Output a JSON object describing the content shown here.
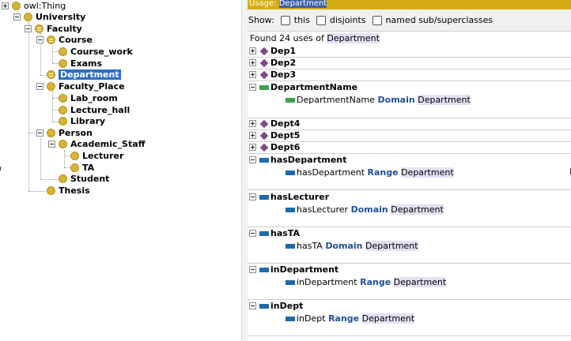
{
  "hierarchy": {
    "nodes": [
      {
        "id": "owl-thing",
        "label": "owl:Thing",
        "toggle": "plus",
        "icon": "class",
        "root": true
      },
      {
        "id": "university",
        "label": "University",
        "toggle": "minus",
        "icon": "class"
      },
      {
        "id": "faculty",
        "label": "Faculty",
        "toggle": "minus",
        "icon": "class-equivalent"
      },
      {
        "id": "course",
        "label": "Course",
        "toggle": "minus",
        "icon": "class-equivalent"
      },
      {
        "id": "course-work",
        "label": "Course_work",
        "toggle": "none",
        "icon": "class"
      },
      {
        "id": "exams",
        "label": "Exams",
        "toggle": "none",
        "icon": "class"
      },
      {
        "id": "department",
        "label": "Department",
        "toggle": "none",
        "icon": "class-equivalent",
        "selected": true
      },
      {
        "id": "faculty-place",
        "label": "Faculty_Place",
        "toggle": "minus",
        "icon": "class"
      },
      {
        "id": "lab-room",
        "label": "Lab_room",
        "toggle": "none",
        "icon": "class"
      },
      {
        "id": "lecture-hall",
        "label": "Lecture_hall",
        "toggle": "none",
        "icon": "class"
      },
      {
        "id": "library",
        "label": "Library",
        "toggle": "none",
        "icon": "class"
      },
      {
        "id": "person",
        "label": "Person",
        "toggle": "minus",
        "icon": "class"
      },
      {
        "id": "academic-staff",
        "label": "Academic_Staff",
        "toggle": "minus",
        "icon": "class"
      },
      {
        "id": "lecturer",
        "label": "Lecturer",
        "toggle": "none",
        "icon": "class"
      },
      {
        "id": "ta",
        "label": "TA",
        "toggle": "none",
        "icon": "class"
      },
      {
        "id": "student",
        "label": "Student",
        "toggle": "none",
        "icon": "class"
      },
      {
        "id": "thesis",
        "label": "Thesis",
        "toggle": "none",
        "icon": "class"
      }
    ]
  },
  "usage": {
    "header_prefix": "Usage: ",
    "header_entity": "Department",
    "show_label": "Show:",
    "filters": [
      {
        "id": "this",
        "label": "this",
        "checked": false
      },
      {
        "id": "disjoints",
        "label": "disjoints",
        "checked": false
      },
      {
        "id": "named-sub-superclasses",
        "label": "named sub/superclasses",
        "checked": false
      }
    ],
    "found_prefix": "Found 24 uses of ",
    "found_entity": "Department",
    "groups": [
      {
        "id": "dep1",
        "label": "Dep1",
        "kind": "individual",
        "expanded": false
      },
      {
        "id": "dep2",
        "label": "Dep2",
        "kind": "individual",
        "expanded": false
      },
      {
        "id": "dep3",
        "label": "Dep3",
        "kind": "individual",
        "expanded": false
      },
      {
        "id": "departmentname",
        "label": "DepartmentName",
        "kind": "data-property",
        "expanded": true,
        "axiom": {
          "subject": "DepartmentName",
          "keyword": "Domain",
          "object": "Department"
        }
      },
      {
        "id": "dept4",
        "label": "Dept4",
        "kind": "individual",
        "expanded": false
      },
      {
        "id": "dept5",
        "label": "Dept5",
        "kind": "individual",
        "expanded": false
      },
      {
        "id": "dept6",
        "label": "Dept6",
        "kind": "individual",
        "expanded": false
      },
      {
        "id": "hasdepartment",
        "label": "hasDepartment",
        "kind": "object-property",
        "expanded": true,
        "axiom": {
          "subject": "hasDepartment",
          "keyword": "Range",
          "object": "Department"
        }
      },
      {
        "id": "haslecturer",
        "label": "hasLecturer",
        "kind": "object-property",
        "expanded": true,
        "axiom": {
          "subject": "hasLecturer",
          "keyword": "Domain",
          "object": "Department"
        }
      },
      {
        "id": "hasta",
        "label": "hasTA",
        "kind": "object-property",
        "expanded": true,
        "axiom": {
          "subject": "hasTA",
          "keyword": "Domain",
          "object": "Department"
        }
      },
      {
        "id": "indepartment",
        "label": "inDepartment",
        "kind": "object-property",
        "expanded": true,
        "axiom": {
          "subject": "inDepartment",
          "keyword": "Range",
          "object": "Department"
        }
      },
      {
        "id": "indept",
        "label": "inDept",
        "kind": "object-property",
        "expanded": true,
        "axiom": {
          "subject": "inDept",
          "keyword": "Range",
          "object": "Department"
        }
      }
    ]
  },
  "colors": {
    "class_icon": "#d8b436",
    "individual_icon": "#7f4a87",
    "data_property_icon": "#3fa34d",
    "object_property_icon": "#1f6aa9",
    "keyword": "#1f4f9a",
    "header_bar": "#d5ac13",
    "selection": "#2d6fc7",
    "entity_highlight": "#e3e0f4"
  }
}
